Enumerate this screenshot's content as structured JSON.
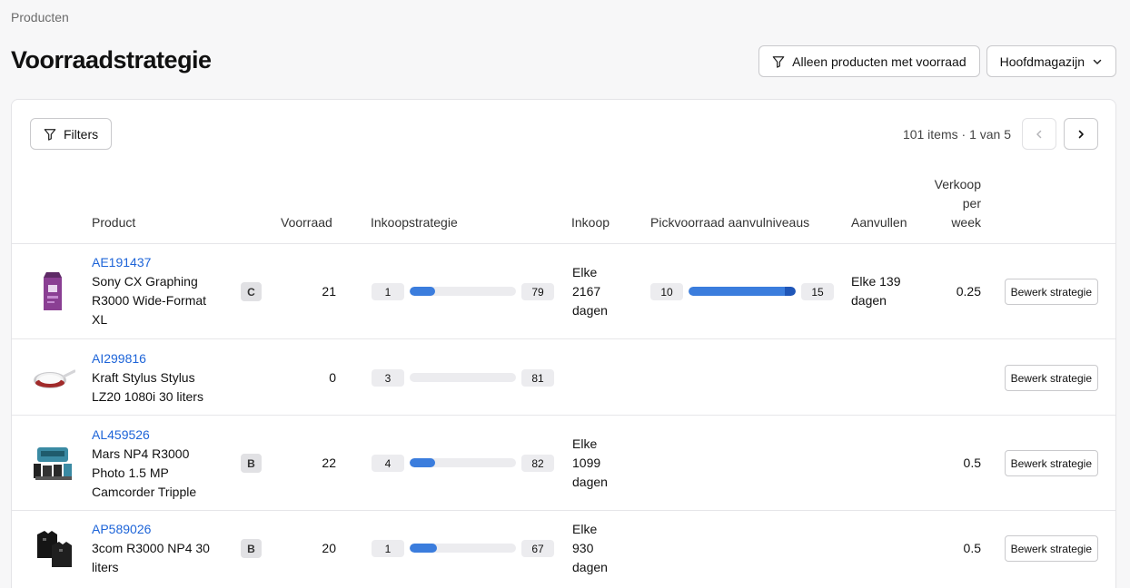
{
  "breadcrumb": "Producten",
  "title": "Voorraadstrategie",
  "top_actions": {
    "stock_filter_label": "Alleen producten met voorraad",
    "warehouse_label": "Hoofdmagazijn"
  },
  "toolbar": {
    "filters_label": "Filters",
    "pager_text": "101 items · 1 van 5"
  },
  "columns": {
    "product": "Product",
    "stock": "Voorraad",
    "purchase_strategy": "Inkoopstrategie",
    "purchase": "Inkoop",
    "pick_levels": "Pickvoorraad aanvulniveaus",
    "replenish": "Aanvullen",
    "sales_per_week_1": "Verkoop",
    "sales_per_week_2": "per",
    "sales_per_week_3": "week"
  },
  "edit_label": "Bewerk strategie",
  "colors": {
    "accent": "#3b7ddd",
    "link": "#1d64d8"
  },
  "rows": [
    {
      "sku": "AE191437",
      "name_1": "Sony CX Graphing",
      "name_2": "R3000 Wide-Format",
      "name_3": "XL",
      "class": "C",
      "stock": "21",
      "strat_min": "1",
      "strat_max": "79",
      "strat_fill": 0.24,
      "purchase_1": "Elke",
      "purchase_2": "2167",
      "purchase_3": "dagen",
      "pick_min": "10",
      "pick_max": "15",
      "pick_fill": 1.0,
      "replenish_1": "Elke 139",
      "replenish_2": "dagen",
      "sales": "0.25"
    },
    {
      "sku": "AI299816",
      "name_1": "Kraft Stylus Stylus",
      "name_2": "LZ20 1080i 30 liters",
      "stock": "0",
      "strat_min": "3",
      "strat_max": "81",
      "strat_fill": 0
    },
    {
      "sku": "AL459526",
      "name_1": "Mars NP4 R3000",
      "name_2": "Photo 1.5 MP",
      "name_3": "Camcorder Tripple",
      "class": "B",
      "stock": "22",
      "strat_min": "4",
      "strat_max": "82",
      "strat_fill": 0.24,
      "purchase_1": "Elke",
      "purchase_2": "1099",
      "purchase_3": "dagen",
      "sales": "0.5"
    },
    {
      "sku": "AP589026",
      "name_1": "3com R3000 NP4 30",
      "name_2": "liters",
      "class": "B",
      "stock": "20",
      "strat_min": "1",
      "strat_max": "67",
      "strat_fill": 0.26,
      "purchase_1": "Elke",
      "purchase_2": "930",
      "purchase_3": "dagen",
      "sales": "0.5"
    }
  ]
}
